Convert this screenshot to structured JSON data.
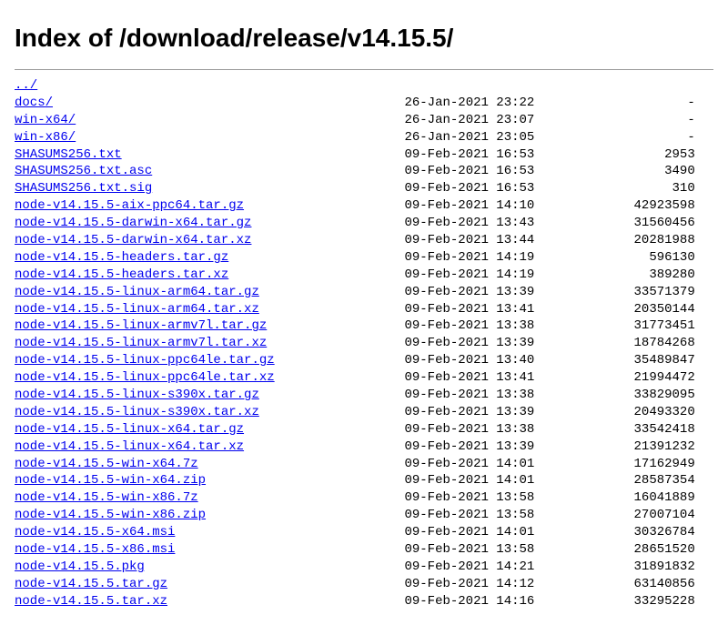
{
  "title": "Index of /download/release/v14.15.5/",
  "parent": {
    "name": "../"
  },
  "entries": [
    {
      "name": "docs/",
      "date": "26-Jan-2021 23:22",
      "size": "-"
    },
    {
      "name": "win-x64/",
      "date": "26-Jan-2021 23:07",
      "size": "-"
    },
    {
      "name": "win-x86/",
      "date": "26-Jan-2021 23:05",
      "size": "-"
    },
    {
      "name": "SHASUMS256.txt",
      "date": "09-Feb-2021 16:53",
      "size": "2953"
    },
    {
      "name": "SHASUMS256.txt.asc",
      "date": "09-Feb-2021 16:53",
      "size": "3490"
    },
    {
      "name": "SHASUMS256.txt.sig",
      "date": "09-Feb-2021 16:53",
      "size": "310"
    },
    {
      "name": "node-v14.15.5-aix-ppc64.tar.gz",
      "date": "09-Feb-2021 14:10",
      "size": "42923598"
    },
    {
      "name": "node-v14.15.5-darwin-x64.tar.gz",
      "date": "09-Feb-2021 13:43",
      "size": "31560456"
    },
    {
      "name": "node-v14.15.5-darwin-x64.tar.xz",
      "date": "09-Feb-2021 13:44",
      "size": "20281988"
    },
    {
      "name": "node-v14.15.5-headers.tar.gz",
      "date": "09-Feb-2021 14:19",
      "size": "596130"
    },
    {
      "name": "node-v14.15.5-headers.tar.xz",
      "date": "09-Feb-2021 14:19",
      "size": "389280"
    },
    {
      "name": "node-v14.15.5-linux-arm64.tar.gz",
      "date": "09-Feb-2021 13:39",
      "size": "33571379"
    },
    {
      "name": "node-v14.15.5-linux-arm64.tar.xz",
      "date": "09-Feb-2021 13:41",
      "size": "20350144"
    },
    {
      "name": "node-v14.15.5-linux-armv7l.tar.gz",
      "date": "09-Feb-2021 13:38",
      "size": "31773451"
    },
    {
      "name": "node-v14.15.5-linux-armv7l.tar.xz",
      "date": "09-Feb-2021 13:39",
      "size": "18784268"
    },
    {
      "name": "node-v14.15.5-linux-ppc64le.tar.gz",
      "date": "09-Feb-2021 13:40",
      "size": "35489847"
    },
    {
      "name": "node-v14.15.5-linux-ppc64le.tar.xz",
      "date": "09-Feb-2021 13:41",
      "size": "21994472"
    },
    {
      "name": "node-v14.15.5-linux-s390x.tar.gz",
      "date": "09-Feb-2021 13:38",
      "size": "33829095"
    },
    {
      "name": "node-v14.15.5-linux-s390x.tar.xz",
      "date": "09-Feb-2021 13:39",
      "size": "20493320"
    },
    {
      "name": "node-v14.15.5-linux-x64.tar.gz",
      "date": "09-Feb-2021 13:38",
      "size": "33542418"
    },
    {
      "name": "node-v14.15.5-linux-x64.tar.xz",
      "date": "09-Feb-2021 13:39",
      "size": "21391232"
    },
    {
      "name": "node-v14.15.5-win-x64.7z",
      "date": "09-Feb-2021 14:01",
      "size": "17162949"
    },
    {
      "name": "node-v14.15.5-win-x64.zip",
      "date": "09-Feb-2021 14:01",
      "size": "28587354"
    },
    {
      "name": "node-v14.15.5-win-x86.7z",
      "date": "09-Feb-2021 13:58",
      "size": "16041889"
    },
    {
      "name": "node-v14.15.5-win-x86.zip",
      "date": "09-Feb-2021 13:58",
      "size": "27007104"
    },
    {
      "name": "node-v14.15.5-x64.msi",
      "date": "09-Feb-2021 14:01",
      "size": "30326784"
    },
    {
      "name": "node-v14.15.5-x86.msi",
      "date": "09-Feb-2021 13:58",
      "size": "28651520"
    },
    {
      "name": "node-v14.15.5.pkg",
      "date": "09-Feb-2021 14:21",
      "size": "31891832"
    },
    {
      "name": "node-v14.15.5.tar.gz",
      "date": "09-Feb-2021 14:12",
      "size": "63140856"
    },
    {
      "name": "node-v14.15.5.tar.xz",
      "date": "09-Feb-2021 14:16",
      "size": "33295228"
    }
  ],
  "columns": {
    "nameWidth": 51,
    "dateWidth": 18,
    "sizeWidth": 20
  }
}
